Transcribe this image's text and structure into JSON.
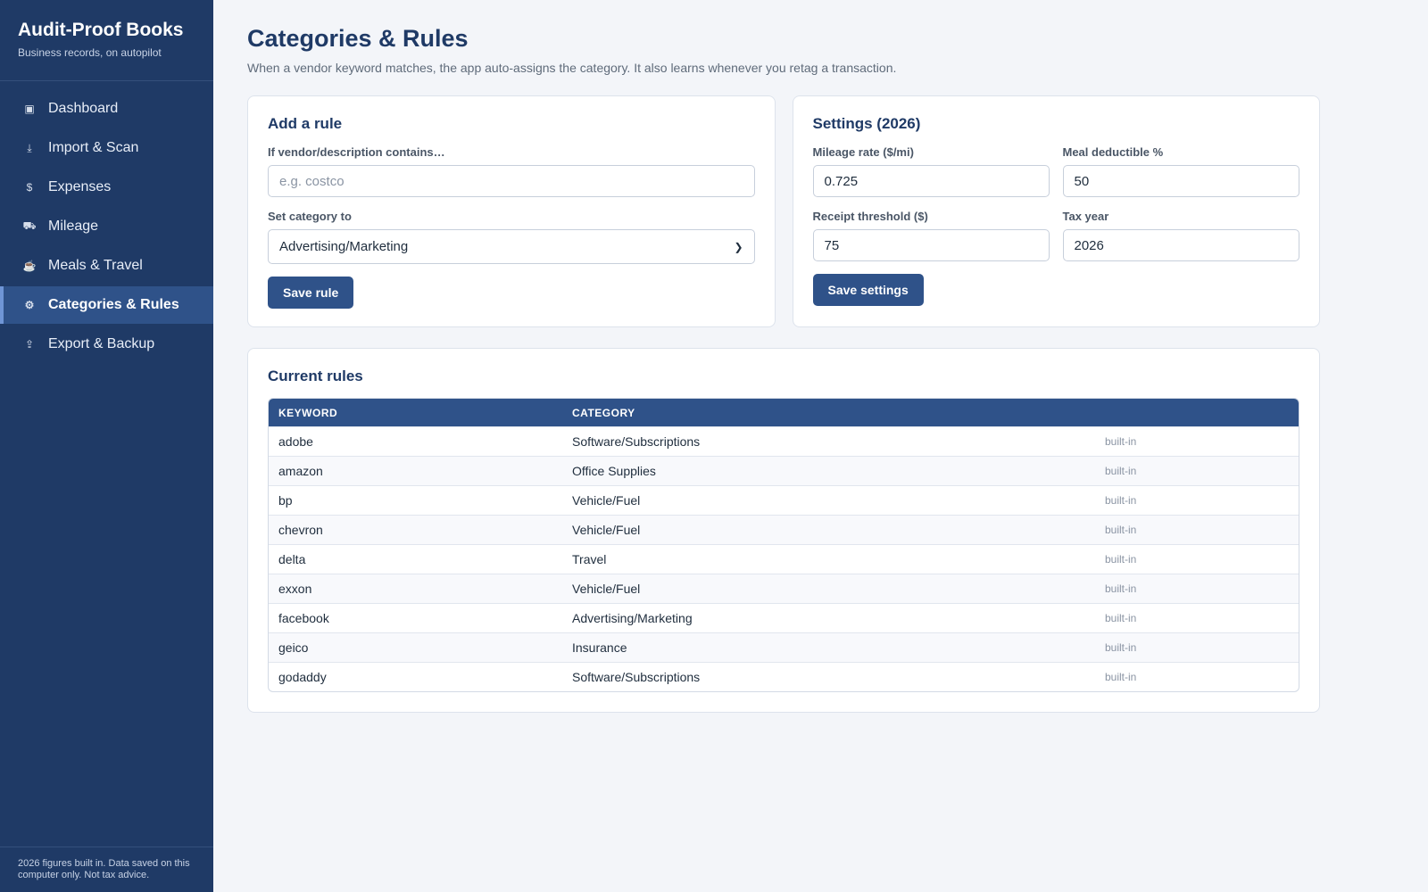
{
  "sidebar": {
    "brand_title": "Audit-Proof Books",
    "brand_subtitle": "Business records, on autopilot",
    "items": [
      {
        "label": "Dashboard",
        "icon": "dashboard-icon",
        "glyph": "▣"
      },
      {
        "label": "Import & Scan",
        "icon": "download-icon",
        "glyph": "⤓"
      },
      {
        "label": "Expenses",
        "icon": "dollar-icon",
        "glyph": "$"
      },
      {
        "label": "Mileage",
        "icon": "truck-icon",
        "glyph": "⛟"
      },
      {
        "label": "Meals & Travel",
        "icon": "coffee-icon",
        "glyph": "☕"
      },
      {
        "label": "Categories & Rules",
        "icon": "gear-icon",
        "glyph": "⚙"
      },
      {
        "label": "Export & Backup",
        "icon": "upload-icon",
        "glyph": "⇪"
      }
    ],
    "active_index": 5,
    "footer": "2026 figures built in. Data saved on this computer only. Not tax advice."
  },
  "header": {
    "title": "Categories & Rules",
    "subtitle": "When a vendor keyword matches, the app auto-assigns the category. It also learns whenever you retag a transaction."
  },
  "add_rule": {
    "title": "Add a rule",
    "contains_label": "If vendor/description contains…",
    "contains_placeholder": "e.g. costco",
    "category_label": "Set category to",
    "category_value": "Advertising/Marketing",
    "save_label": "Save rule"
  },
  "settings": {
    "title": "Settings (2026)",
    "mileage_label": "Mileage rate ($/mi)",
    "mileage_value": "0.725",
    "meal_label": "Meal deductible %",
    "meal_value": "50",
    "receipt_label": "Receipt threshold ($)",
    "receipt_value": "75",
    "taxyear_label": "Tax year",
    "taxyear_value": "2026",
    "save_label": "Save settings"
  },
  "rules": {
    "title": "Current rules",
    "columns": [
      "KEYWORD",
      "CATEGORY"
    ],
    "rows": [
      {
        "keyword": "adobe",
        "category": "Software/Subscriptions",
        "source": "built-in"
      },
      {
        "keyword": "amazon",
        "category": "Office Supplies",
        "source": "built-in"
      },
      {
        "keyword": "bp",
        "category": "Vehicle/Fuel",
        "source": "built-in"
      },
      {
        "keyword": "chevron",
        "category": "Vehicle/Fuel",
        "source": "built-in"
      },
      {
        "keyword": "delta",
        "category": "Travel",
        "source": "built-in"
      },
      {
        "keyword": "exxon",
        "category": "Vehicle/Fuel",
        "source": "built-in"
      },
      {
        "keyword": "facebook",
        "category": "Advertising/Marketing",
        "source": "built-in"
      },
      {
        "keyword": "geico",
        "category": "Insurance",
        "source": "built-in"
      },
      {
        "keyword": "godaddy",
        "category": "Software/Subscriptions",
        "source": "built-in"
      }
    ]
  },
  "colors": {
    "sidebar": "#1f3a66",
    "accent": "#2f5289",
    "background": "#f3f5f9"
  }
}
